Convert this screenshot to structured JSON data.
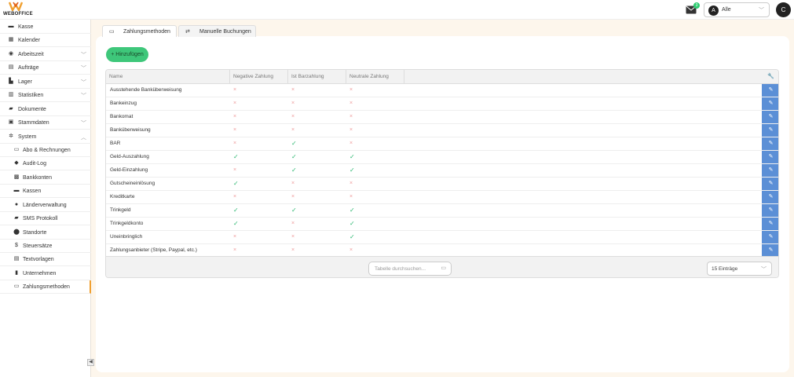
{
  "brand": {
    "name": "WEBOFFICE"
  },
  "header": {
    "mail_icon": "mail-icon",
    "mail_badge": "3",
    "user_select": {
      "avatar": "A",
      "value": "Alle"
    },
    "profile_initial": "C"
  },
  "sidebar": {
    "items": [
      {
        "label": "Kasse",
        "icon": "cash-register-icon",
        "expand": false
      },
      {
        "label": "Kalender",
        "icon": "calendar-icon",
        "expand": false
      },
      {
        "label": "Arbeitszeit",
        "icon": "clock-icon",
        "expand": true
      },
      {
        "label": "Aufträge",
        "icon": "orders-icon",
        "expand": true
      },
      {
        "label": "Lager",
        "icon": "warehouse-icon",
        "expand": true
      },
      {
        "label": "Statistiken",
        "icon": "chart-icon",
        "expand": true
      },
      {
        "label": "Dokumente",
        "icon": "folder-icon",
        "expand": false
      },
      {
        "label": "Stammdaten",
        "icon": "database-icon",
        "expand": true
      },
      {
        "label": "System",
        "icon": "gears-icon",
        "expand": true
      }
    ],
    "subitems": [
      {
        "label": "Abo & Rechnungen",
        "icon": "invoice-icon"
      },
      {
        "label": "Audit-Log",
        "icon": "shield-icon"
      },
      {
        "label": "Bankkonten",
        "icon": "bank-icon"
      },
      {
        "label": "Kassen",
        "icon": "register-icon"
      },
      {
        "label": "Länderverwaltung",
        "icon": "globe-icon"
      },
      {
        "label": "SMS Protokoll",
        "icon": "sms-icon"
      },
      {
        "label": "Standorte",
        "icon": "location-pin-icon"
      },
      {
        "label": "Steuersätze",
        "icon": "dollar-icon"
      },
      {
        "label": "Textvorlagen",
        "icon": "template-icon"
      },
      {
        "label": "Unternehmen",
        "icon": "building-icon"
      },
      {
        "label": "Zahlungsmethoden",
        "icon": "payment-icon"
      }
    ]
  },
  "tabs": [
    {
      "label": "Zahlungsmethoden",
      "icon": "payment-icon"
    },
    {
      "label": "Manuelle Buchungen",
      "icon": "transfer-icon"
    }
  ],
  "add_button": "+ Hinzufügen",
  "table": {
    "columns": [
      "Name",
      "Negative Zahlung",
      "Ist Barzahlung",
      "Neutrale Zahlung"
    ],
    "rows": [
      {
        "name": "Ausstehende Banküberweisung",
        "neg": false,
        "bar": false,
        "neu": false
      },
      {
        "name": "Bankeinzug",
        "neg": false,
        "bar": false,
        "neu": false
      },
      {
        "name": "Bankomat",
        "neg": false,
        "bar": false,
        "neu": false
      },
      {
        "name": "Banküberweisung",
        "neg": false,
        "bar": false,
        "neu": false
      },
      {
        "name": "BAR",
        "neg": false,
        "bar": true,
        "neu": false
      },
      {
        "name": "Geld-Auszahlung",
        "neg": true,
        "bar": true,
        "neu": true
      },
      {
        "name": "Geld-Einzahlung",
        "neg": false,
        "bar": true,
        "neu": true
      },
      {
        "name": "Gutscheineinlösung",
        "neg": true,
        "bar": false,
        "neu": false
      },
      {
        "name": "Kreditkarte",
        "neg": false,
        "bar": false,
        "neu": false
      },
      {
        "name": "Trinkgeld",
        "neg": true,
        "bar": true,
        "neu": true
      },
      {
        "name": "Trinkgeldkonto",
        "neg": true,
        "bar": false,
        "neu": true
      },
      {
        "name": "Uneinbringlich",
        "neg": false,
        "bar": false,
        "neu": true
      },
      {
        "name": "Zahlungsanbieter (Stripe, Paypal, etc.)",
        "neg": false,
        "bar": false,
        "neu": false
      }
    ],
    "search_placeholder": "Tabelle durchsuchen...",
    "page_size": "15 Einträge"
  },
  "colors": {
    "accent": "#3ec77a",
    "edit": "#5b8fd6",
    "active_marker": "#f0a030",
    "check": "#2eb872",
    "cross": "#ee9999"
  }
}
